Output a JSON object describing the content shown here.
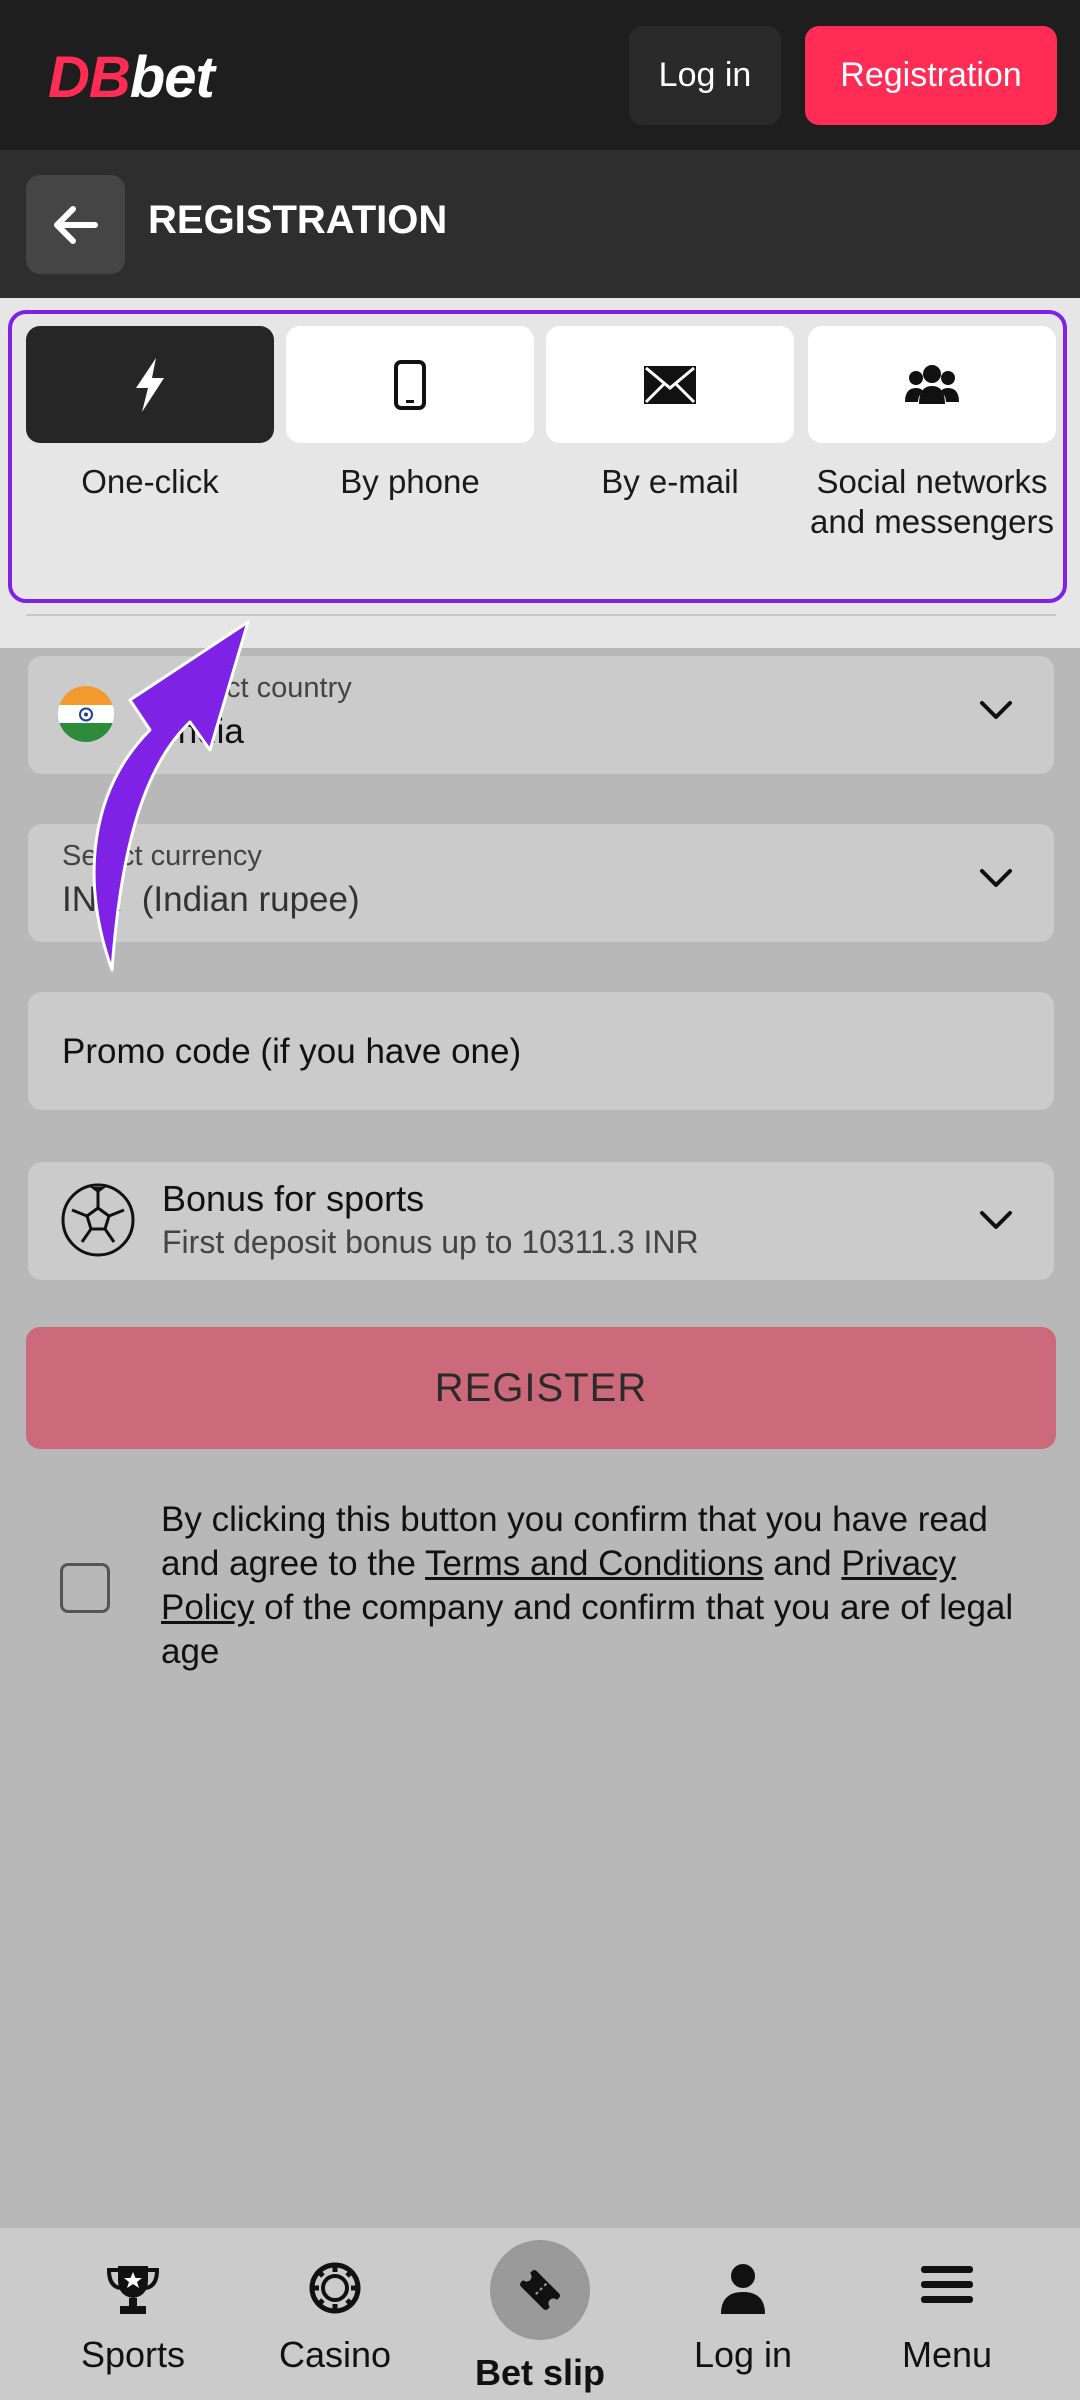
{
  "header": {
    "logo_db": "DB",
    "logo_bet": "bet",
    "login_label": "Log in",
    "registration_label": "Registration"
  },
  "subheader": {
    "title": "REGISTRATION",
    "back_icon": "arrow-left-icon"
  },
  "tabs": [
    {
      "label": "One-click",
      "icon": "lightning-icon",
      "active": true
    },
    {
      "label": "By phone",
      "icon": "phone-icon",
      "active": false
    },
    {
      "label": "By e-mail",
      "icon": "envelope-icon",
      "active": false
    },
    {
      "label": "Social networks and messengers",
      "icon": "users-icon",
      "active": false
    }
  ],
  "form": {
    "country": {
      "label": "Select country",
      "value": "India"
    },
    "currency": {
      "label": "Select currency",
      "value": "INR  (Indian rupee)"
    },
    "promo_placeholder": "Promo code (if you have one)",
    "bonus": {
      "title": "Bonus for sports",
      "subtitle": "First deposit bonus up to 10311.3 INR"
    },
    "register_label": "REGISTER",
    "terms": {
      "part1": "By clicking this button you confirm that you have read and agree to the ",
      "terms_link": "Terms and Conditions",
      "part2": " and ",
      "privacy_link": "Privacy Policy",
      "part3": " of the company and confirm that you are of legal age"
    }
  },
  "bottom_nav": [
    {
      "label": "Sports",
      "icon": "trophy-icon"
    },
    {
      "label": "Casino",
      "icon": "casino-chip-icon"
    },
    {
      "label": "Bet slip",
      "icon": "ticket-icon"
    },
    {
      "label": "Log in",
      "icon": "user-icon"
    },
    {
      "label": "Menu",
      "icon": "hamburger-icon"
    }
  ],
  "colors": {
    "brand": "#ff2d55",
    "highlight": "#7e22e6",
    "register_bg": "#cc6a7b"
  }
}
